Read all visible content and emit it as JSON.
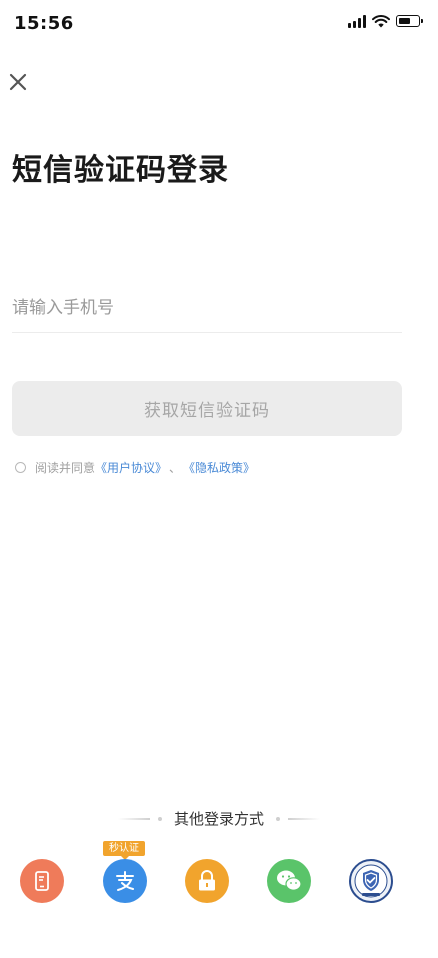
{
  "status_bar": {
    "time": "15:56"
  },
  "page": {
    "title": "短信验证码登录"
  },
  "phone": {
    "placeholder": "请输入手机号",
    "value": ""
  },
  "sms_button_label": "获取短信验证码",
  "agreement": {
    "checked": false,
    "prefix": "阅读并同意",
    "user_agreement": "《用户协议》",
    "separator": "、",
    "privacy_policy": "《隐私政策》"
  },
  "other_login": {
    "title": "其他登录方式",
    "badge": "秒认证",
    "methods": [
      {
        "name": "phone-icon",
        "color": "#ef7b5a"
      },
      {
        "name": "alipay-icon",
        "color": "#3a8ee6"
      },
      {
        "name": "lock-icon",
        "color": "#f1a42d"
      },
      {
        "name": "wechat-icon",
        "color": "#5ac46a"
      },
      {
        "name": "gov-shield-icon",
        "color": "#2c4d8f"
      }
    ]
  },
  "colors": {
    "link": "#4a8ad6",
    "button_bg": "#ececec",
    "button_text": "#a6a6a6"
  }
}
